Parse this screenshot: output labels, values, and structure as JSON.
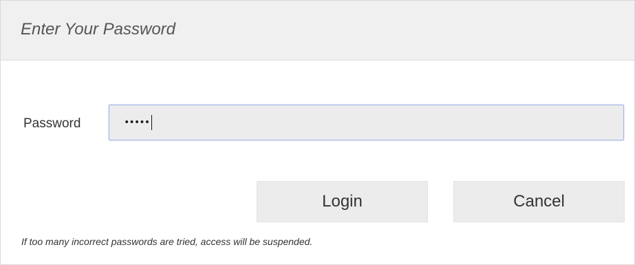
{
  "dialog": {
    "title": "Enter Your Password"
  },
  "form": {
    "password_label": "Password",
    "password_masked_value": "•••••",
    "password_length": 5
  },
  "buttons": {
    "login_label": "Login",
    "cancel_label": "Cancel"
  },
  "footer": {
    "warning": "If too many incorrect passwords are tried, access will be suspended."
  },
  "colors": {
    "header_bg": "#f0f0f0",
    "input_bg": "#ececec",
    "input_focus_border": "#a4b6e6",
    "button_bg": "#ececec"
  }
}
